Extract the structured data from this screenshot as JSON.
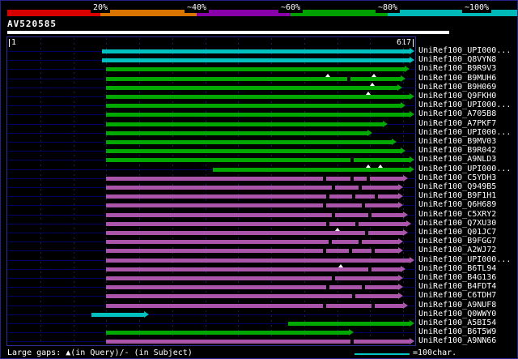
{
  "colors": {
    "background": "#000000",
    "text": "#ffffff",
    "cyan": "#00c0c0",
    "green": "#00a800",
    "purple": "#aa55aa",
    "query_line": "#000066",
    "plot_border": "#2f2f96",
    "query_bar": "#ffffff",
    "scale_line": "#00c8c8",
    "scale_segment_colors": [
      "#d80000",
      "#d87400",
      "#8800a8",
      "#00a000",
      "#00b8b8"
    ]
  },
  "scale_bar": {
    "labels": [
      "20%",
      "~40%",
      "~60%",
      "~80%",
      "~100%"
    ]
  },
  "query": {
    "name": "AV520585"
  },
  "ruler": {
    "start": "1",
    "end": "617"
  },
  "footer": {
    "legend_text": "Large gaps: ▲(in Query)/- (in Subject)",
    "scale_text": "=100char."
  },
  "chart_data": {
    "type": "bar",
    "orientation": "horizontal",
    "title": "AV520585",
    "x_range": [
      1,
      617
    ],
    "x_unit": "residues",
    "grid": true,
    "legend_position": "top",
    "identity_legend": [
      {
        "label": "20%",
        "color_name": "red"
      },
      {
        "label": "~40%",
        "color_name": "orange"
      },
      {
        "label": "~60%",
        "color_name": "purple"
      },
      {
        "label": "~80%",
        "color_name": "green"
      },
      {
        "label": "~100%",
        "color_name": "cyan"
      }
    ],
    "hits": [
      {
        "label": "UniRef100_UPI000...",
        "color": "cyan",
        "start": 143,
        "end": 617
      },
      {
        "label": "UniRef100_Q8VYN8",
        "color": "cyan",
        "start": 143,
        "end": 617
      },
      {
        "label": "UniRef100_B9R9V3",
        "color": "green",
        "start": 149,
        "end": 610
      },
      {
        "label": "UniRef100_B9MUH6",
        "color": "green",
        "start": 149,
        "end": 604,
        "query_gaps": [
          486,
          556
        ],
        "subject_gaps": [
          515
        ]
      },
      {
        "label": "UniRef100_B9H069",
        "color": "green",
        "start": 149,
        "end": 598,
        "query_gaps": [
          553
        ]
      },
      {
        "label": "UniRef100_Q9FKH0",
        "color": "green",
        "start": 149,
        "end": 617,
        "query_gaps": [
          547
        ]
      },
      {
        "label": "UniRef100_UPI000...",
        "color": "green",
        "start": 149,
        "end": 604
      },
      {
        "label": "UniRef100_A705B8",
        "color": "green",
        "start": 149,
        "end": 617
      },
      {
        "label": "UniRef100_A7PKF7",
        "color": "green",
        "start": 149,
        "end": 576
      },
      {
        "label": "UniRef100_UPI000...",
        "color": "green",
        "start": 149,
        "end": 553
      },
      {
        "label": "UniRef100_B9MV03",
        "color": "green",
        "start": 149,
        "end": 590
      },
      {
        "label": "UniRef100_B9R042",
        "color": "green",
        "start": 149,
        "end": 604
      },
      {
        "label": "UniRef100_A9NLD3",
        "color": "green",
        "start": 149,
        "end": 617,
        "subject_gaps": [
          520
        ]
      },
      {
        "label": "UniRef100_UPI000...",
        "color": "green",
        "start": 311,
        "end": 617,
        "query_gaps": [
          547,
          566
        ]
      },
      {
        "label": "UniRef100_C5YDH3",
        "color": "purple",
        "start": 149,
        "end": 607,
        "subject_gaps": [
          478,
          520,
          545
        ]
      },
      {
        "label": "UniRef100_Q949B5",
        "color": "purple",
        "start": 149,
        "end": 600,
        "subject_gaps": [
          492,
          532
        ]
      },
      {
        "label": "UniRef100_B9F1H1",
        "color": "purple",
        "start": 149,
        "end": 600,
        "subject_gaps": [
          483,
          522,
          557
        ]
      },
      {
        "label": "UniRef100_Q6H689",
        "color": "purple",
        "start": 149,
        "end": 600,
        "subject_gaps": [
          478,
          537
        ]
      },
      {
        "label": "UniRef100_C5XRY2",
        "color": "purple",
        "start": 149,
        "end": 607,
        "subject_gaps": [
          492,
          547
        ]
      },
      {
        "label": "UniRef100_Q7XU30",
        "color": "purple",
        "start": 149,
        "end": 612,
        "subject_gaps": [
          483,
          527
        ]
      },
      {
        "label": "UniRef100_Q01JC7",
        "color": "purple",
        "start": 149,
        "end": 607,
        "query_gaps": [
          500
        ],
        "subject_gaps": [
          542
        ]
      },
      {
        "label": "UniRef100_B9FGG7",
        "color": "purple",
        "start": 149,
        "end": 600,
        "subject_gaps": [
          487,
          532
        ]
      },
      {
        "label": "UniRef100_A2WJ72",
        "color": "purple",
        "start": 149,
        "end": 600,
        "subject_gaps": [
          478,
          517,
          552
        ]
      },
      {
        "label": "UniRef100_UPI000...",
        "color": "purple",
        "start": 149,
        "end": 617
      },
      {
        "label": "UniRef100_B6TL94",
        "color": "purple",
        "start": 149,
        "end": 604,
        "query_gaps": [
          505
        ],
        "subject_gaps": [
          547
        ]
      },
      {
        "label": "UniRef100_B4G136",
        "color": "purple",
        "start": 149,
        "end": 600,
        "subject_gaps": [
          492
        ]
      },
      {
        "label": "UniRef100_B4FDT4",
        "color": "purple",
        "start": 149,
        "end": 600,
        "subject_gaps": [
          483,
          537
        ]
      },
      {
        "label": "UniRef100_C6TDH7",
        "color": "purple",
        "start": 149,
        "end": 600,
        "subject_gaps": [
          522
        ]
      },
      {
        "label": "UniRef100_A9NUF8",
        "color": "purple",
        "start": 149,
        "end": 607,
        "subject_gaps": [
          478,
          552
        ]
      },
      {
        "label": "UniRef100_Q0WWY0",
        "color": "cyan",
        "start": 127,
        "end": 215
      },
      {
        "label": "UniRef100_A5BI54",
        "color": "green",
        "start": 425,
        "end": 617
      },
      {
        "label": "UniRef100_B6T5W9",
        "color": "green",
        "start": 149,
        "end": 525
      },
      {
        "label": "UniRef100_A9NN66",
        "color": "purple",
        "start": 149,
        "end": 617,
        "subject_gaps": [
          520
        ]
      }
    ]
  }
}
